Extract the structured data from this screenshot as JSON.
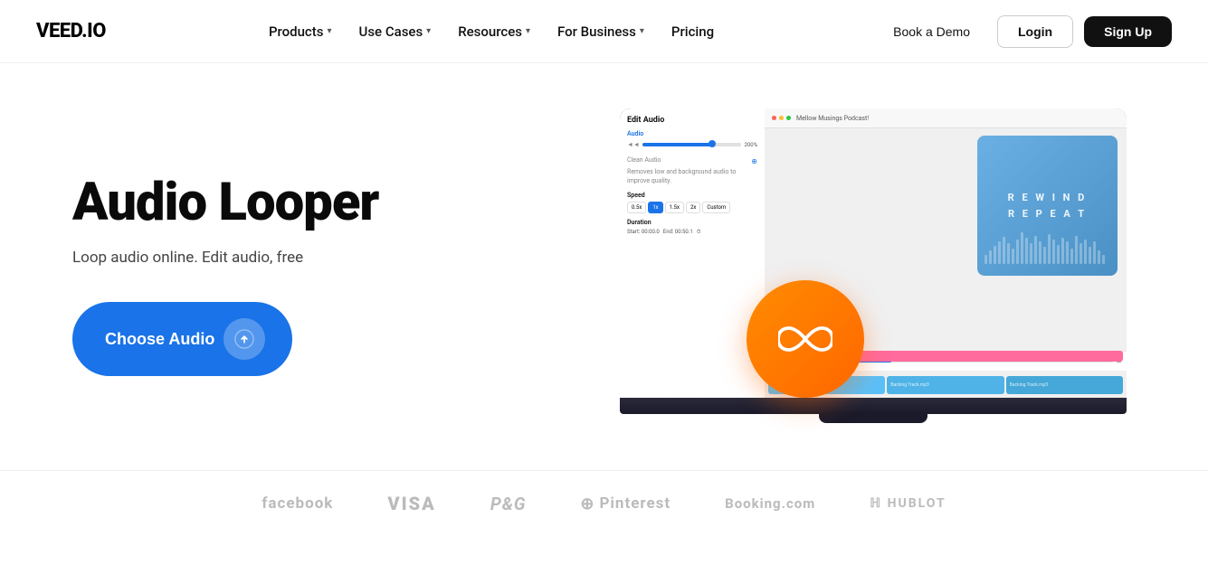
{
  "nav": {
    "logo": "VEED.IO",
    "links": [
      {
        "label": "Products",
        "has_dropdown": true
      },
      {
        "label": "Use Cases",
        "has_dropdown": true
      },
      {
        "label": "Resources",
        "has_dropdown": true
      },
      {
        "label": "For Business",
        "has_dropdown": true
      },
      {
        "label": "Pricing",
        "has_dropdown": false
      }
    ],
    "book_demo": "Book a Demo",
    "login": "Login",
    "signup": "Sign Up"
  },
  "hero": {
    "title": "Audio Looper",
    "subtitle": "Loop audio online. Edit audio, free",
    "cta": "Choose Audio",
    "upload_icon": "↑"
  },
  "screen": {
    "title": "Edit Audio",
    "podcast_title_line1": "R E W I N D",
    "podcast_title_line2": "R E P E A T",
    "speed_options": [
      "0.5x",
      "1x",
      "1.5x",
      "2x",
      "Custom"
    ],
    "panel_labels": {
      "audio": "Audio",
      "clean_audio": "Clean Audio",
      "speed": "Speed",
      "duration": "Duration"
    },
    "track_labels": [
      "Backing Track.mp3",
      "Backing Track.mp3",
      "Backing Track.mp3"
    ]
  },
  "logos": [
    {
      "name": "facebook",
      "text": "facebook"
    },
    {
      "name": "visa",
      "text": "VISA"
    },
    {
      "name": "pg",
      "text": "P&G"
    },
    {
      "name": "pinterest",
      "text": "Pinterest"
    },
    {
      "name": "booking",
      "text": "Booking.com"
    },
    {
      "name": "hublot",
      "text": "ℍ HUBLOT"
    }
  ]
}
